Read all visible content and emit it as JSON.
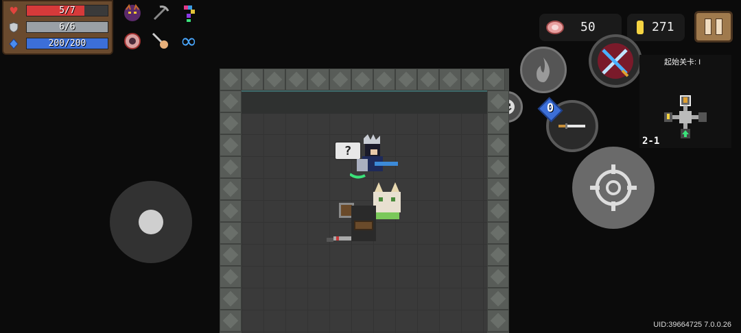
{
  "stats": {
    "hp": {
      "text": "5/7",
      "current": 5,
      "max": 7,
      "color": "#d63a3a"
    },
    "armor": {
      "text": "6/6",
      "current": 6,
      "max": 6,
      "color": "#9aa0a6"
    },
    "energy": {
      "text": "200/200",
      "current": 200,
      "max": 200,
      "color": "#3c6fd8"
    }
  },
  "buffs": {
    "infinity_symbol": "∞"
  },
  "resources": {
    "food_count": "50",
    "gold_count": "271"
  },
  "skill": {
    "ammo_cost": "0"
  },
  "emote": {
    "question_bubble": "?"
  },
  "minimap": {
    "title": "起始关卡: I",
    "level": "2-1"
  },
  "footer": {
    "uid_text": "UID:39664725 7.0.0.26"
  },
  "colors": {
    "accent_gold": "#f5d442",
    "panel_brown": "#6a4a2e",
    "wall_stone": "#585c58",
    "floor": "#3a3a3a"
  }
}
